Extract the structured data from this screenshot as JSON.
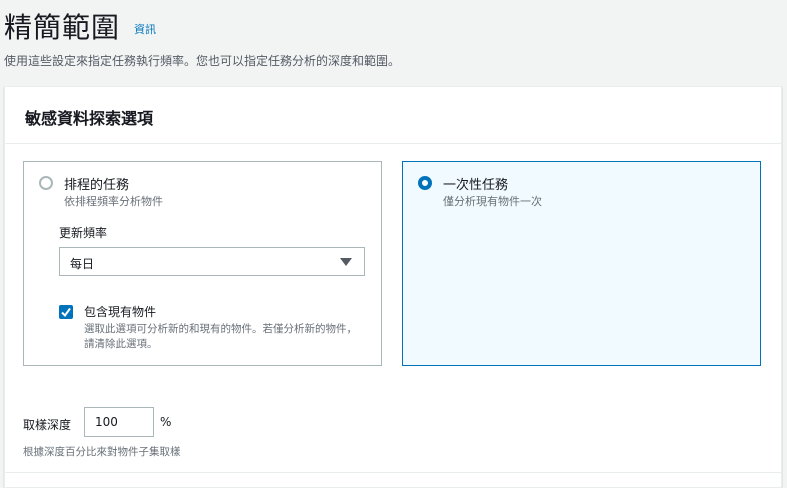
{
  "header": {
    "title": "精簡範圍",
    "info_link": "資訊",
    "description": "使用這些設定來指定任務執行頻率。您也可以指定任務分析的深度和範圍。"
  },
  "panel": {
    "title": "敏感資料探索選項",
    "options": [
      {
        "label": "排程的任務",
        "description": "依排程頻率分析物件",
        "selected": false
      },
      {
        "label": "一次性任務",
        "description": "僅分析現有物件一次",
        "selected": true
      }
    ],
    "frequency": {
      "label": "更新頻率",
      "selected": "每日"
    },
    "include_existing": {
      "label": "包含現有物件",
      "description": "選取此選項可分析新的和現有的物件。若僅分析新的物件，請清除此選項。",
      "checked": true
    },
    "sampling": {
      "label": "取樣深度",
      "value": "100",
      "unit": "%",
      "description": "根據深度百分比來對物件子集取樣"
    }
  },
  "colors": {
    "accent": "#0073bb",
    "selected_tile_bg": "#f1faff",
    "border": "#aab7b8",
    "page_bg": "#f2f3f3"
  }
}
